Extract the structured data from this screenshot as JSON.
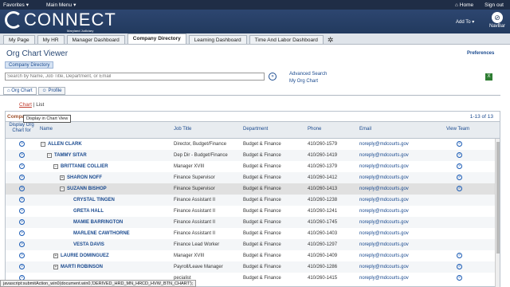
{
  "topbar": {
    "favorites": "Favorites",
    "main_menu": "Main Menu",
    "home": "Home",
    "signout": "Sign out"
  },
  "banner": {
    "logo_text": "CONNECT",
    "logo_sub": "Maryland Judiciary",
    "add_to": "Add To",
    "navbar": "NavBar"
  },
  "tabs": [
    "My Page",
    "My HR",
    "Manager Dashboard",
    "Company Directory",
    "Learning Dashboard",
    "Time And Labor Dashboard"
  ],
  "active_tab": "Company Directory",
  "page": {
    "title": "Org Chart Viewer",
    "preferences": "Preferences",
    "directory_button": "Company Directory",
    "search_placeholder": "Search by Name, Job Title, Department, or Email",
    "advanced_search": "Advanced Search",
    "my_org_chart": "My Org Chart",
    "subtabs": [
      "Org Chart",
      "Profile"
    ],
    "chart_link": "Chart",
    "list_label": "List"
  },
  "grid": {
    "header_label": "Compan",
    "count": "1-13 of 13",
    "tooltip": "Display in Chart View",
    "columns": {
      "display": "Display Org Chart for",
      "name": "Name",
      "job": "Job Title",
      "dept": "Department",
      "phone": "Phone",
      "email": "Email",
      "view": "View Team"
    },
    "rows": [
      {
        "name": "ALLEN CLARK",
        "job": "Director, Budget/Finance",
        "dept": "Budget & Finance",
        "phone": "410/260-1579",
        "email": "noreply@mdcourts.gov",
        "level": 0,
        "expander": "minus",
        "team": true
      },
      {
        "name": "TAMMY SITAR",
        "job": "Dep Dir - Budget/Finance",
        "dept": "Budget & Finance",
        "phone": "410/260-1419",
        "email": "noreply@mdcourts.gov",
        "level": 1,
        "expander": "minus",
        "team": true
      },
      {
        "name": "BRITTANIE COLLIER",
        "job": "Manager XVIII",
        "dept": "Budget & Finance",
        "phone": "410/260-1379",
        "email": "noreply@mdcourts.gov",
        "level": 2,
        "expander": "minus",
        "team": true
      },
      {
        "name": "SHARON NOFF",
        "job": "Finance Supervisor",
        "dept": "Budget & Finance",
        "phone": "410/260-1412",
        "email": "noreply@mdcourts.gov",
        "level": 3,
        "expander": "plus",
        "team": true
      },
      {
        "name": "SUZANN BISHOP",
        "job": "Finance Supervisor",
        "dept": "Budget & Finance",
        "phone": "410/260-1413",
        "email": "noreply@mdcourts.gov",
        "level": 3,
        "expander": "minus",
        "team": true,
        "selected": true
      },
      {
        "name": "CRYSTAL TINGEN",
        "job": "Finance Assistant II",
        "dept": "Budget & Finance",
        "phone": "410/260-1238",
        "email": "noreply@mdcourts.gov",
        "level": 4,
        "expander": "",
        "team": false
      },
      {
        "name": "GRETA HALL",
        "job": "Finance Assistant II",
        "dept": "Budget & Finance",
        "phone": "410/260-1241",
        "email": "noreply@mdcourts.gov",
        "level": 4,
        "expander": "",
        "team": false
      },
      {
        "name": "MAMIE BARRINGTON",
        "job": "Finance Assistant II",
        "dept": "Budget & Finance",
        "phone": "410/260-1745",
        "email": "noreply@mdcourts.gov",
        "level": 4,
        "expander": "",
        "team": false
      },
      {
        "name": "MARLENE CAWTHORNE",
        "job": "Finance Assistant II",
        "dept": "Budget & Finance",
        "phone": "410/260-1403",
        "email": "noreply@mdcourts.gov",
        "level": 4,
        "expander": "",
        "team": false
      },
      {
        "name": "VESTA DAVIS",
        "job": "Finance Lead Worker",
        "dept": "Budget & Finance",
        "phone": "410/260-1297",
        "email": "noreply@mdcourts.gov",
        "level": 4,
        "expander": "",
        "team": false
      },
      {
        "name": "LAURIE DOMINGUEZ",
        "job": "Manager XVIII",
        "dept": "Budget & Finance",
        "phone": "410/260-1409",
        "email": "noreply@mdcourts.gov",
        "level": 2,
        "expander": "plus",
        "team": true
      },
      {
        "name": "MARTI ROBINSON",
        "job": "Payroll/Leave Manager",
        "dept": "Budget & Finance",
        "phone": "410/260-1286",
        "email": "noreply@mdcourts.gov",
        "level": 2,
        "expander": "plus",
        "team": true
      },
      {
        "name": "",
        "job": "pecialist",
        "dept": "Budget & Finance",
        "phone": "410/260-1415",
        "email": "noreply@mdcourts.gov",
        "level": 2,
        "expander": "",
        "team": true
      }
    ]
  },
  "statusbar": "javascript:submitAction_win0(document.win0,'DERIVED_HRD_MN_HRCD_HVW_BTN_CHART');"
}
